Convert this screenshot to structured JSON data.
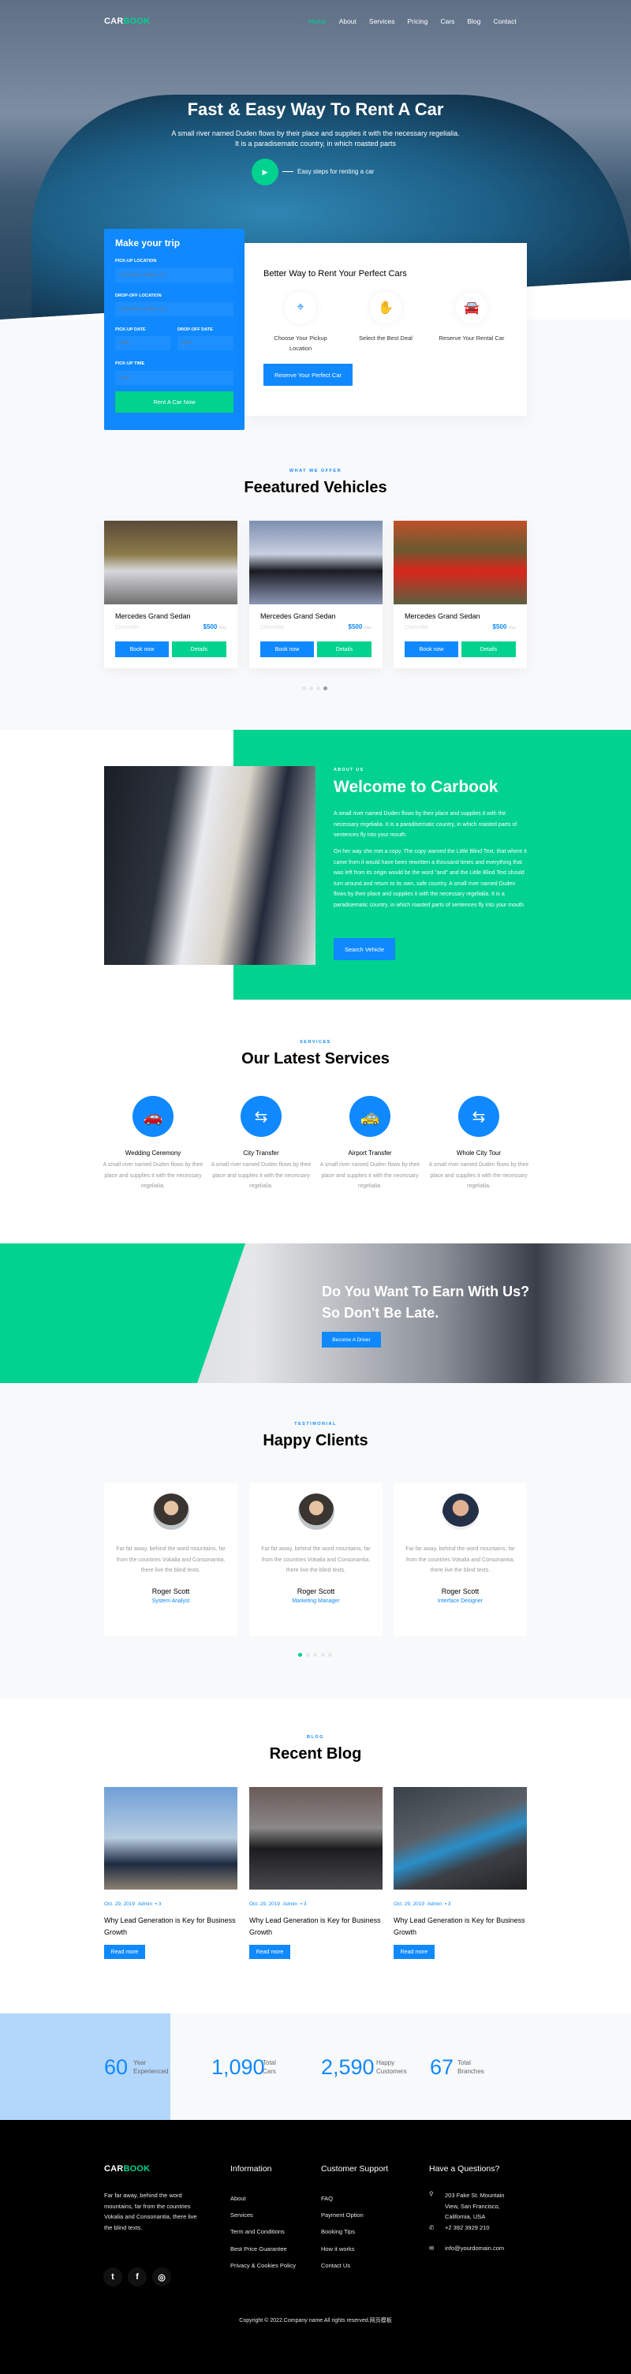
{
  "colors": {
    "primary": "#1089ff",
    "accent": "#01d28e",
    "footer_bg": "#000000"
  },
  "header": {
    "logo_car": "CAR",
    "logo_book": "BOOK",
    "nav": [
      "Home",
      "About",
      "Services",
      "Pricing",
      "Cars",
      "Blog",
      "Contact"
    ],
    "active_nav": "Home"
  },
  "hero": {
    "title": "Fast & Easy Way To Rent A Car",
    "subtitle": "A small river named Duden flows by their place and supplies it with the necessary regelialia. It is a paradisematic country, in which roasted parts",
    "play_icon": "play-icon",
    "steps_label": "Easy steps for renting a car"
  },
  "trip_form": {
    "title": "Make your trip",
    "pickup_location_label": "PICK-UP LOCATION",
    "pickup_location_placeholder": "City, Airport, Station, etc",
    "dropoff_location_label": "DROP-OFF LOCATION",
    "dropoff_location_placeholder": "City, Airport, Station, etc",
    "pickup_date_label": "PICK-UP DATE",
    "pickup_date_placeholder": "Date",
    "dropoff_date_label": "DROP-OFF DATE",
    "dropoff_date_placeholder": "Date",
    "pickup_time_label": "PICK-UP TIME",
    "pickup_time_placeholder": "Time",
    "submit": "Rent A Car Now"
  },
  "why": {
    "title": "Better Way to Rent Your Perfect Cars",
    "steps": [
      {
        "icon": "route-pin-icon",
        "label": "Choose Your Pickup Location"
      },
      {
        "icon": "handshake-icon",
        "label": "Select the Best Deal"
      },
      {
        "icon": "rental-car-icon",
        "label": "Reserve Your Rental Car"
      }
    ],
    "button": "Reserve Your Perfect Car"
  },
  "featured": {
    "kicker": "WHAT WE OFFER",
    "title": "Feeatured Vehicles",
    "cars": [
      {
        "name": "Mercedes Grand Sedan",
        "brand": "Chevrolet",
        "price": "$500",
        "unit": "/day",
        "book": "Book now",
        "details": "Details"
      },
      {
        "name": "Mercedes Grand Sedan",
        "brand": "Chevrolet",
        "price": "$500",
        "unit": "/day",
        "book": "Book now",
        "details": "Details"
      },
      {
        "name": "Mercedes Grand Sedan",
        "brand": "Chevrolet",
        "price": "$500",
        "unit": "/day",
        "book": "Book now",
        "details": "Details"
      }
    ],
    "carousel_pages": 4,
    "carousel_active": 4
  },
  "about": {
    "kicker": "ABOUT US",
    "title": "Welcome to Carbook",
    "p1": "A small river named Duden flows by their place and supplies it with the necessary regelialia. It is a paradisematic country, in which roasted parts of sentences fly into your mouth.",
    "p2": "On her way she met a copy. The copy warned the Little Blind Text, that where it came from it would have been rewritten a thousand times and everything that was left from its origin would be the word \"and\" and the Little Blind Text should turn around and return to its own, safe country. A small river named Duden flows by their place and supplies it with the necessary regelialia. It is a paradisematic country, in which roasted parts of sentences fly into your mouth.",
    "button": "Search Vehicle"
  },
  "services": {
    "kicker": "SERVICES",
    "title": "Our Latest Services",
    "items": [
      {
        "icon": "wedding-car-icon",
        "title": "Wedding Ceremony",
        "text": "A small river named Duden flows by their place and supplies it with the necessary regelialia."
      },
      {
        "icon": "city-route-icon",
        "title": "City Transfer",
        "text": "A small river named Duden flows by their place and supplies it with the necessary regelialia."
      },
      {
        "icon": "taxi-icon",
        "title": "Airport Transfer",
        "text": "A small river named Duden flows by their place and supplies it with the necessary regelialia."
      },
      {
        "icon": "tour-route-icon",
        "title": "Whole City Tour",
        "text": "A small river named Duden flows by their place and supplies it with the necessary regelialia."
      }
    ]
  },
  "driver_banner": {
    "title": "Do You Want To Earn With Us? So Don't Be Late.",
    "button": "Become A Driver"
  },
  "testimonials": {
    "kicker": "TESTIMONIAL",
    "title": "Happy Clients",
    "items": [
      {
        "text": "Far far away, behind the word mountains, far from the countries Vokalia and Consonantia, there live the blind texts.",
        "name": "Roger Scott",
        "role": "System Analyst"
      },
      {
        "text": "Far far away, behind the word mountains, far from the countries Vokalia and Consonantia, there live the blind texts.",
        "name": "Roger Scott",
        "role": "Marketing Manager"
      },
      {
        "text": "Far far away, behind the word mountains, far from the countries Vokalia and Consonantia, there live the blind texts.",
        "name": "Roger Scott",
        "role": "Interface Designer"
      }
    ],
    "carousel_pages": 5,
    "carousel_active": 1
  },
  "blog": {
    "kicker": "BLOG",
    "title": "Recent Blog",
    "posts": [
      {
        "date": "Oct. 29, 2019",
        "author": "Admin",
        "comments": "3",
        "title": "Why Lead Generation is Key for Business Growth",
        "button": "Read more"
      },
      {
        "date": "Oct. 29, 2019",
        "author": "Admin",
        "comments": "3",
        "title": "Why Lead Generation is Key for Business Growth",
        "button": "Read more"
      },
      {
        "date": "Oct. 29, 2019",
        "author": "Admin",
        "comments": "3",
        "title": "Why Lead Generation is Key for Business Growth",
        "button": "Read more"
      }
    ]
  },
  "stats": [
    {
      "value": "60",
      "l1": "Year",
      "l2": "Experienced"
    },
    {
      "value": "1,090",
      "l1": "Total",
      "l2": "Cars"
    },
    {
      "value": "2,590",
      "l1": "Happy",
      "l2": "Customers"
    },
    {
      "value": "67",
      "l1": "Total",
      "l2": "Branches"
    }
  ],
  "footer": {
    "logo_car": "CAR",
    "logo_book": "BOOK",
    "about": "Far far away, behind the word mountains, far from the countries Vokalia and Consonantia, there live the blind texts.",
    "socials": [
      "twitter-icon",
      "facebook-icon",
      "instagram-icon"
    ],
    "info_title": "Information",
    "info_links": [
      "About",
      "Services",
      "Term and Conditions",
      "Best Price Guarantee",
      "Privacy & Cookies Policy"
    ],
    "support_title": "Customer Support",
    "support_links": [
      "FAQ",
      "Payment Option",
      "Booking Tips",
      "How it works",
      "Contact Us"
    ],
    "contact_title": "Have a Questions?",
    "address": "203 Fake St. Mountain View, San Francisco, California, USA",
    "phone": "+2 392 3929 210",
    "email": "info@yourdomain.com",
    "copyright": "Copyright © 2022.Company name All rights reserved.网页模板"
  }
}
